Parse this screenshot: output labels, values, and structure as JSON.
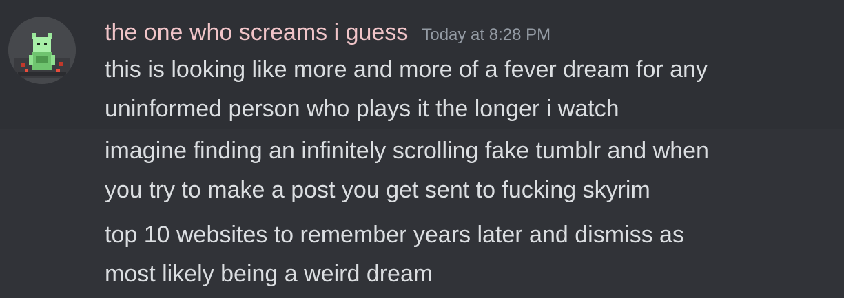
{
  "message_group": {
    "author": {
      "username": "the one who screams i guess",
      "username_color": "#f0c4c8",
      "avatar_icon": "pixel-creature-avatar"
    },
    "timestamp": "Today at 8:28 PM",
    "messages": [
      {
        "lines": [
          "this is looking like more and more of a fever dream for any",
          "uninformed person who plays it the longer i watch"
        ]
      },
      {
        "lines": [
          "imagine finding an infinitely scrolling fake tumblr and when",
          "you try to make a post you get sent to fucking skyrim"
        ]
      },
      {
        "lines": [
          "top 10 websites to remember years later and dismiss as",
          "most likely being a weird dream"
        ]
      }
    ]
  },
  "colors": {
    "background": "#313338",
    "hovered_message_background": "#2e3035",
    "text": "#dbdee1",
    "timestamp": "#949ba4"
  }
}
